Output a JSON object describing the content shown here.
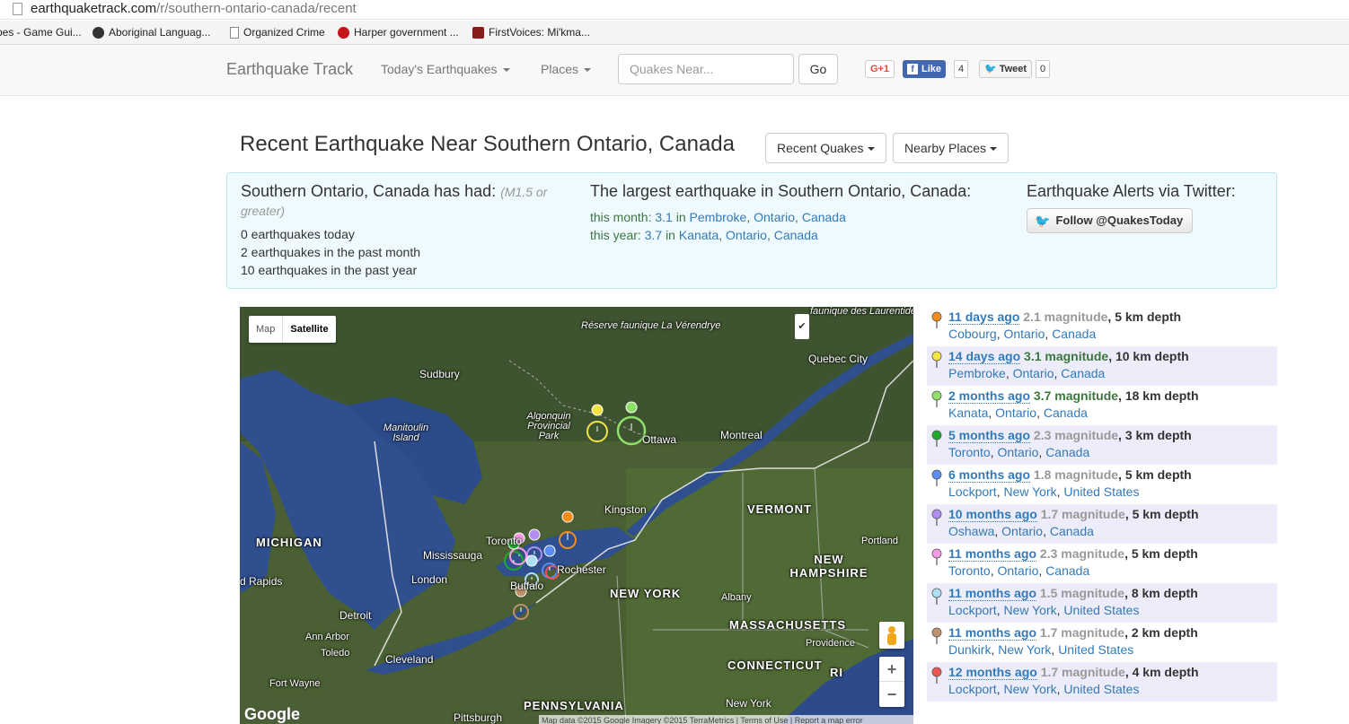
{
  "browser": {
    "url_domain": "earthquaketrack.com",
    "url_path": "/r/southern-ontario-canada/recent",
    "bookmarks": [
      {
        "label": "pes - Game Gui...",
        "icon": "none"
      },
      {
        "label": "Aboriginal Languag...",
        "icon": "dark-globe-icon"
      },
      {
        "label": "Organized Crime",
        "icon": "page-icon"
      },
      {
        "label": "Harper government ...",
        "icon": "cbc-icon"
      },
      {
        "label": "FirstVoices: Mi'kma...",
        "icon": "flag-icon"
      }
    ]
  },
  "nav": {
    "brand": "Earthquake Track",
    "todays": "Today's Earthquakes",
    "places": "Places",
    "search_placeholder": "Quakes Near...",
    "go": "Go",
    "gplus": "G+1",
    "like": "Like",
    "like_count": "4",
    "tweet": "Tweet",
    "tweet_count": "0"
  },
  "header": {
    "title": "Recent Earthquake Near Southern Ontario, Canada",
    "recent_btn": "Recent Quakes",
    "nearby_btn": "Nearby Places"
  },
  "info": {
    "had_heading": "Southern Ontario, Canada has had:",
    "had_sub": "(M1.5 or greater)",
    "today": "0 earthquakes today",
    "month": "2 earthquakes in the past month",
    "year": "10 earthquakes in the past year",
    "largest_heading": "The largest earthquake in Southern Ontario, Canada:",
    "month_label": "this month:",
    "month_mag": "3.1",
    "month_city": "Pembroke",
    "month_region": "Ontario",
    "month_country": "Canada",
    "year_label": "this year:",
    "year_mag": "3.7",
    "year_city": "Kanata",
    "year_region": "Ontario",
    "year_country": "Canada",
    "in": "in",
    "twitter_heading": "Earthquake Alerts via Twitter:",
    "follow": "Follow @QuakesToday"
  },
  "map": {
    "type_map": "Map",
    "type_satellite": "Satellite",
    "zoom_in": "+",
    "zoom_out": "−",
    "footer": "Map data ©2015 Google Imagery ©2015 TerraMetrics  |  Terms of Use  |  Report a map error",
    "google": "Google",
    "labels": {
      "reserve": "Réserve faunique La Vérendrye",
      "laurentides": "faunique des Laurentides",
      "sudbury": "Sudbury",
      "quebec": "Quebec City",
      "manitoulin": "Manitoulin Island",
      "algonquin": "Algonquin Provincial Park",
      "ottawa": "Ottawa",
      "montreal": "Montreal",
      "kingston": "Kingston",
      "vermont": "VERMONT",
      "michigan": "MICHIGAN",
      "toronto": "Toronto",
      "mississauga": "Mississauga",
      "portland": "Portland",
      "rochester": "Rochester",
      "new_hampshire": "NEW HAMPSHIRE",
      "rapids": "d Rapids",
      "london": "London",
      "buffalo": "Buffalo",
      "new_york_state": "NEW YORK",
      "albany": "Albany",
      "detroit": "Detroit",
      "massachusetts": "MASSACHUSETTS",
      "ann_arbor": "Ann Arbor",
      "providence": "Providence",
      "toledo": "Toledo",
      "cleveland": "Cleveland",
      "connecticut": "CONNECTICUT",
      "ri": "RI",
      "fort_wayne": "Fort Wayne",
      "new_york_city": "New York",
      "pennsylvania": "PENNSYLVANIA",
      "pittsburgh": "Pittsburgh"
    }
  },
  "quakes": [
    {
      "time": "11 days ago",
      "mag": "2.1 magnitude",
      "depth": "5 km depth",
      "city": "Cobourg",
      "region": "Ontario",
      "country": "Canada",
      "color": "#f28c1a",
      "highlight": false
    },
    {
      "time": "14 days ago",
      "mag": "3.1 magnitude",
      "depth": "10 km depth",
      "city": "Pembroke",
      "region": "Ontario",
      "country": "Canada",
      "color": "#f4e542",
      "highlight": true
    },
    {
      "time": "2 months ago",
      "mag": "3.7 magnitude",
      "depth": "18 km depth",
      "city": "Kanata",
      "region": "Ontario",
      "country": "Canada",
      "color": "#8ee06b",
      "highlight": true
    },
    {
      "time": "5 months ago",
      "mag": "2.3 magnitude",
      "depth": "3 km depth",
      "city": "Toronto",
      "region": "Ontario",
      "country": "Canada",
      "color": "#1faa2d",
      "highlight": false
    },
    {
      "time": "6 months ago",
      "mag": "1.8 magnitude",
      "depth": "5 km depth",
      "city": "Lockport",
      "region": "New York",
      "country": "United States",
      "color": "#5b8df2",
      "highlight": false
    },
    {
      "time": "10 months ago",
      "mag": "1.7 magnitude",
      "depth": "5 km depth",
      "city": "Oshawa",
      "region": "Ontario",
      "country": "Canada",
      "color": "#b18ef0",
      "highlight": false
    },
    {
      "time": "11 months ago",
      "mag": "2.3 magnitude",
      "depth": "5 km depth",
      "city": "Toronto",
      "region": "Ontario",
      "country": "Canada",
      "color": "#f59be6",
      "highlight": false
    },
    {
      "time": "11 months ago",
      "mag": "1.5 magnitude",
      "depth": "8 km depth",
      "city": "Lockport",
      "region": "New York",
      "country": "United States",
      "color": "#aee0f5",
      "highlight": false
    },
    {
      "time": "11 months ago",
      "mag": "1.7 magnitude",
      "depth": "2 km depth",
      "city": "Dunkirk",
      "region": "New York",
      "country": "United States",
      "color": "#c0906a",
      "highlight": false
    },
    {
      "time": "12 months ago",
      "mag": "1.7 magnitude",
      "depth": "4 km depth",
      "city": "Lockport",
      "region": "New York",
      "country": "United States",
      "color": "#ee5555",
      "highlight": false
    }
  ]
}
